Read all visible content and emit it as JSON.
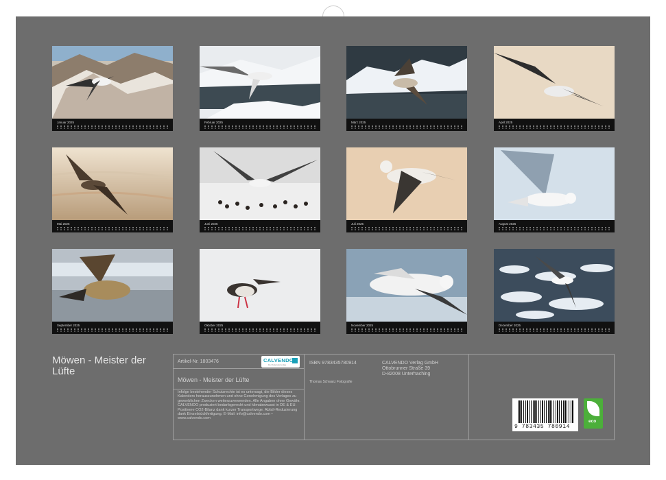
{
  "calendar": {
    "title": "Möwen - Meister der Lüfte",
    "months": [
      {
        "label": "Januar 2025"
      },
      {
        "label": "Februar 2025"
      },
      {
        "label": "März 2025"
      },
      {
        "label": "April 2025"
      },
      {
        "label": "Mai 2025"
      },
      {
        "label": "Juni 2025"
      },
      {
        "label": "Juli 2025"
      },
      {
        "label": "August 2025"
      },
      {
        "label": "September 2025"
      },
      {
        "label": "Oktober 2025"
      },
      {
        "label": "November 2025"
      },
      {
        "label": "Dezember 2025"
      }
    ]
  },
  "info": {
    "article_no": "Artikel-Nr. 1803476",
    "logo_text": "CALVENDO",
    "logo_sub": "Der Kalenderverlag",
    "product_title": "Möwen - Meister der Lüfte",
    "legal_text": "Infolge bestehender Schutzrechte ist es untersagt, die Bilder dieses Kalenders herauszunehmen und ohne Genehmigung des Verlages zu gewerblichen Zwecken weiterzuverwenden. Alle Angaben ohne Gewähr. CALVENDO produziert bedarfsgerecht und klimabewusst in DE & EU. Positivere CO2-Bilanz dank kurzer Transportwege. Abfall-Reduzierung dank Einzelstückfertigung. E-Mail: info@calvendo.com • www.calvendo.com",
    "isbn": "ISBN 9783435780914",
    "photographer": "Thomas Schwarz Fotografie",
    "publisher_lines": [
      "CALVENDO Verlag GmbH",
      "Ottobrunner Straße 39",
      "D-82008 Unterhaching"
    ],
    "barcode_number": "9 783435 780914",
    "eco_label": "eco"
  },
  "colors": {
    "background": "#6d6d6d",
    "strip": "#111111",
    "eco_green": "#4caf3a",
    "calvendo_teal": "#1aa0b8"
  }
}
